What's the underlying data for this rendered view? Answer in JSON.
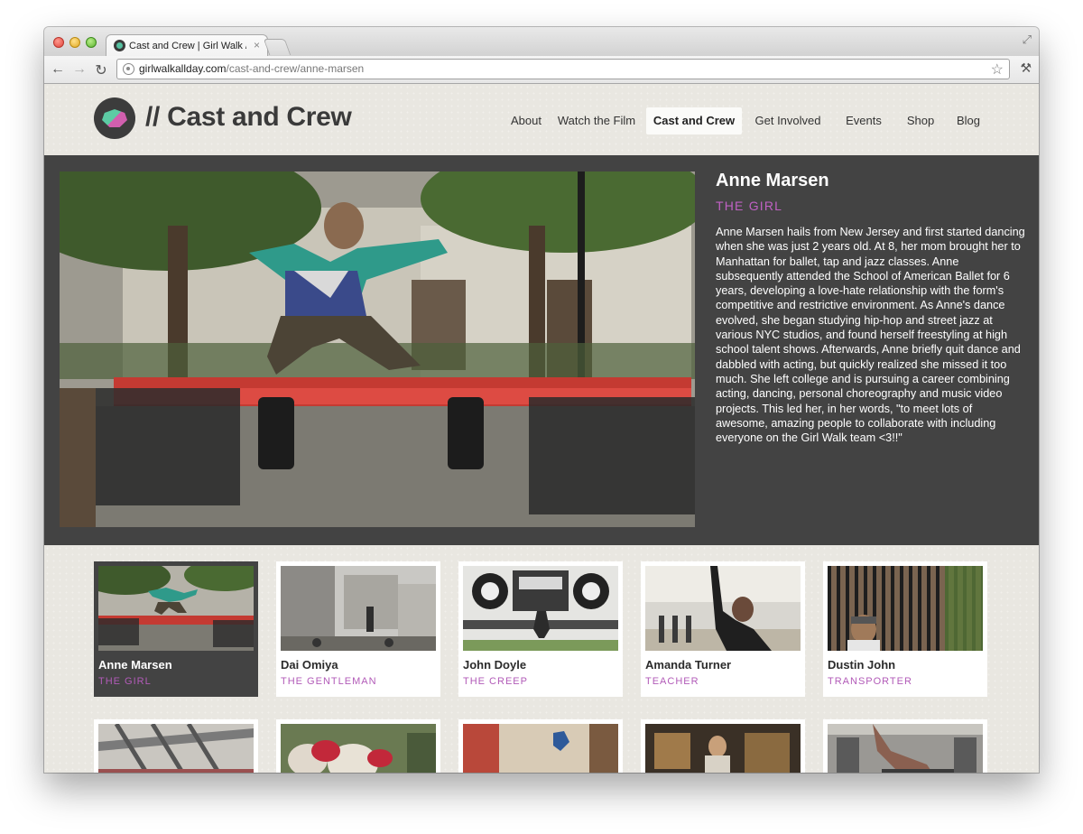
{
  "browser": {
    "tab_title": "Cast and Crew | Girl Walk //",
    "tab_close": "×",
    "url_domain": "girlwalkallday.com",
    "url_path": "/cast-and-crew/anne-marsen",
    "back_icon": "←",
    "forward_icon": "→",
    "reload_icon": "↻",
    "star_icon": "☆",
    "wrench_icon": "⚒"
  },
  "site": {
    "title": "// Cast and Crew",
    "nav": [
      {
        "label": "About",
        "active": false
      },
      {
        "label": "Watch the Film",
        "active": false
      },
      {
        "label": "Cast and Crew",
        "active": true
      },
      {
        "label": "Get Involved",
        "active": false
      },
      {
        "label": "Events",
        "active": false
      },
      {
        "label": "Shop",
        "active": false
      },
      {
        "label": "Blog",
        "active": false
      }
    ]
  },
  "feature": {
    "name": "Anne Marsen",
    "role": "THE GIRL",
    "bio": "Anne Marsen hails from New Jersey and first started dancing when she was just 2 years old. At 8, her mom brought her to Manhattan for ballet, tap and jazz classes. Anne subsequently attended the School of American Ballet for 6 years, developing a love-hate relationship with the form's competitive and restrictive environment. As Anne's dance evolved, she began studying hip-hop and street jazz at various NYC studios, and found herself freestyling at high school talent shows. Afterwards, Anne briefly quit dance and dabbled with acting, but quickly realized she missed it too much. She left college and is pursuing a career combining acting, dancing, personal choreography and music video projects. This led her, in her words, \"to meet lots of awesome, amazing people to collaborate with including everyone on the Girl Walk team <3!!\""
  },
  "cast": [
    {
      "name": "Anne Marsen",
      "role": "THE GIRL",
      "active": true
    },
    {
      "name": "Dai Omiya",
      "role": "THE GENTLEMAN",
      "active": false
    },
    {
      "name": "John Doyle",
      "role": "THE CREEP",
      "active": false
    },
    {
      "name": "Amanda Turner",
      "role": "TEACHER",
      "active": false
    },
    {
      "name": "Dustin John",
      "role": "TRANSPORTER",
      "active": false
    }
  ],
  "colors": {
    "accent": "#c061c4",
    "feature_bg": "#434343",
    "page_bg": "#e9e7e1"
  }
}
